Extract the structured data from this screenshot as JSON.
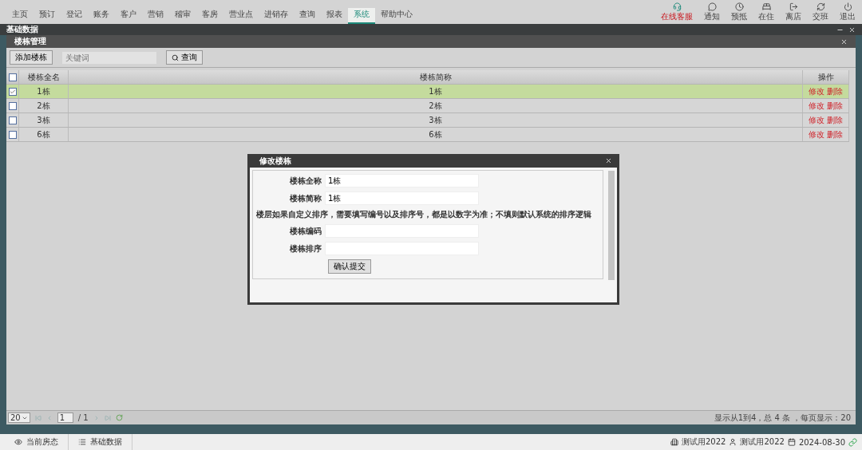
{
  "nav": {
    "tabs": [
      {
        "label": "主页",
        "selected": false
      },
      {
        "label": "预订",
        "selected": false
      },
      {
        "label": "登记",
        "selected": false
      },
      {
        "label": "账务",
        "selected": false
      },
      {
        "label": "客户",
        "selected": false
      },
      {
        "label": "营销",
        "selected": false
      },
      {
        "label": "稽审",
        "selected": false
      },
      {
        "label": "客房",
        "selected": false
      },
      {
        "label": "营业点",
        "selected": false
      },
      {
        "label": "进销存",
        "selected": false
      },
      {
        "label": "查询",
        "selected": false
      },
      {
        "label": "报表",
        "selected": false
      },
      {
        "label": "系统",
        "selected": true
      },
      {
        "label": "帮助中心",
        "selected": false
      }
    ],
    "tools": [
      {
        "kind": "service",
        "label": "在线客服"
      },
      {
        "kind": "notice",
        "label": "通知"
      },
      {
        "kind": "clock",
        "label": "预抵"
      },
      {
        "kind": "bed",
        "label": "在住"
      },
      {
        "kind": "exit",
        "label": "离店"
      },
      {
        "kind": "swap",
        "label": "交班"
      },
      {
        "kind": "power",
        "label": "退出"
      }
    ]
  },
  "window": {
    "title": "基础数据"
  },
  "panel": {
    "title": "楼栋管理",
    "add_button": "添加楼栋",
    "search": {
      "placeholder": "关键词"
    },
    "search_button": "查询"
  },
  "table": {
    "select_all_checked": false,
    "columns": [
      "楼栋全名",
      "楼栋简称",
      "操作"
    ],
    "rows": [
      {
        "full_name": "1栋",
        "short_name": "1栋",
        "edit": "修改",
        "delete": "删除",
        "selected": true,
        "checked": true
      },
      {
        "full_name": "2栋",
        "short_name": "2栋",
        "edit": "修改",
        "delete": "删除",
        "selected": false,
        "checked": false
      },
      {
        "full_name": "3栋",
        "short_name": "3栋",
        "edit": "修改",
        "delete": "删除",
        "selected": false,
        "checked": false
      },
      {
        "full_name": "6栋",
        "short_name": "6栋",
        "edit": "修改",
        "delete": "删除",
        "selected": false,
        "checked": false
      }
    ]
  },
  "pager": {
    "page_size": "20",
    "page": "1",
    "total_pages": "/ 1",
    "summary": "显示从1到4，总 4 条 ，每页显示：20"
  },
  "dialog": {
    "title": "修改楼栋",
    "fields_top": [
      {
        "label": "楼栋全称",
        "value": "1栋"
      },
      {
        "label": "楼栋简称",
        "value": "1栋"
      }
    ],
    "note": "楼层如果自定义排序，需要填写编号以及排序号，都是以数字为准；不填则默认系统的排序逻辑",
    "fields_bottom": [
      {
        "label": "楼栋编码"
      },
      {
        "label": "楼栋排序"
      }
    ],
    "submit": "确认提交"
  },
  "status_bar": {
    "tabs": [
      {
        "kind": "eye",
        "label": "当前房态"
      },
      {
        "kind": "list",
        "label": "基础数据"
      }
    ],
    "hotel": "测试用2022",
    "user": "测试用2022",
    "date": "2024-08-30"
  }
}
